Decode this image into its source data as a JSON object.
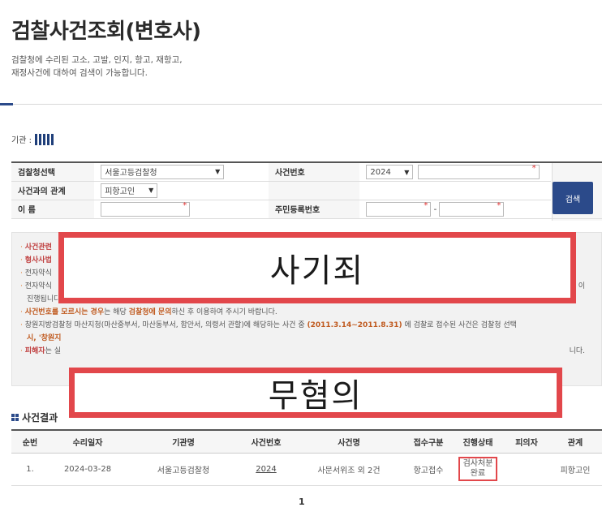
{
  "page": {
    "title": "검찰사건조회(변호사)",
    "description_line1": "검찰청에 수리된 고소, 고발, 인지, 항고, 재항고,",
    "description_line2": "재정사건에 대하여 검색이 가능합니다."
  },
  "agency": {
    "label": "기관 :"
  },
  "search_form": {
    "prosecutor_label": "검찰청선택",
    "prosecutor_value": "서울고등검찰청",
    "case_number_label": "사건번호",
    "case_year": "2024",
    "relation_label": "사건과의 관계",
    "relation_value": "피항고인",
    "name_label": "이 름",
    "resident_label": "주민등록번호",
    "search_button": "검색"
  },
  "notice": {
    "line1": "사건관련",
    "line2": "형사사법",
    "line3": "전자약식",
    "line4": "전자약식",
    "line4_tail": "이",
    "line5": "진행됩니다.)",
    "line6_a": "사건번호를 모르시는 경우",
    "line6_b": "는 해당 ",
    "line6_c": "검찰청에 문의",
    "line6_d": "하신 후 이용하여 주시기 바랍니다.",
    "line7_a": "창원지방검찰청 마산지청(마산중부서, 마산동부서, 함안서, 의령서 관할)에 해당하는 사건 중 ",
    "line7_b": "(2011.3.14~2011.8.31)",
    "line7_c": " 에 검찰로 접수된 사건은 검찰청 선택",
    "line8_a": "시, '창원지",
    "line9_a": "피해자",
    "line9_b": "는 실",
    "line9_tail": "니다."
  },
  "overlays": {
    "top_text": "사기죄",
    "bottom_text": "무혐의"
  },
  "results": {
    "title": "사건결과",
    "columns": [
      "순번",
      "수리일자",
      "기관명",
      "사건번호",
      "사건명",
      "접수구분",
      "진행상태",
      "피의자",
      "관계"
    ],
    "rows": [
      {
        "no": "1.",
        "date": "2024-03-28",
        "agency": "서울고등검찰청",
        "case_no": "2024",
        "case_name": "사문서위조 외 2건",
        "type": "항고접수",
        "status_line1": "검사처분",
        "status_line2": "완료",
        "suspect": "",
        "relation": "피항고인"
      }
    ]
  },
  "pagination": {
    "current": "1"
  },
  "colors": {
    "accent_blue": "#2b4a8a",
    "highlight_red": "#e2474b",
    "notice_orange": "#c05a1f"
  }
}
